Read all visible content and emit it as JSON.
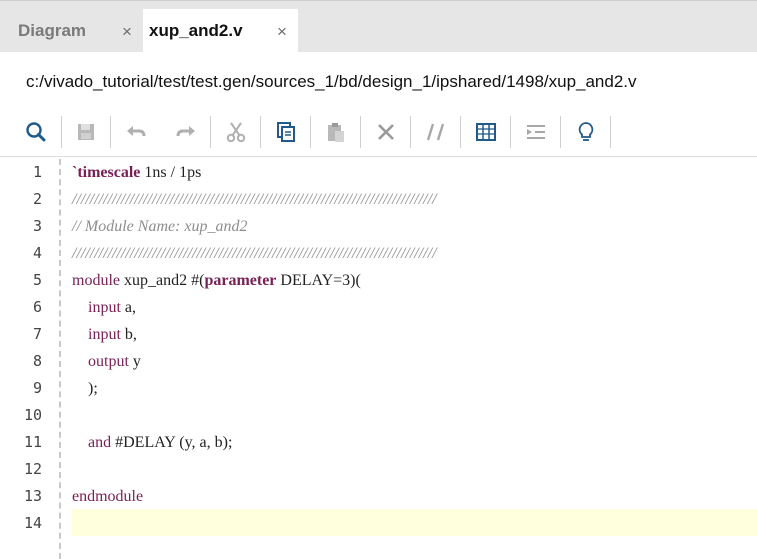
{
  "tabs": [
    {
      "label": "Diagram",
      "close": "×",
      "active": false
    },
    {
      "label": "xup_and2.v",
      "close": "×",
      "active": true
    }
  ],
  "file_path": "c:/vivado_tutorial/test/test.gen/sources_1/bd/design_1/ipshared/1498/xup_and2.v",
  "toolbar": {
    "icons": [
      "search-icon",
      "save-icon",
      "undo-icon",
      "redo-icon",
      "cut-icon",
      "copy-icon",
      "paste-icon",
      "delete-icon",
      "comment-icon",
      "column-icon",
      "indent-icon",
      "lightbulb-icon"
    ]
  },
  "editor": {
    "current_line": 14,
    "lines": [
      {
        "n": "1",
        "tokens": [
          {
            "t": "`",
            "c": "kwb"
          },
          {
            "t": "timescale",
            "c": "kwb"
          },
          {
            "t": " 1ns / 1ps",
            "c": ""
          }
        ]
      },
      {
        "n": "2",
        "tokens": [
          {
            "t": "//////////////////////////////////////////////////////////////////////////////////",
            "c": "cm"
          }
        ]
      },
      {
        "n": "3",
        "tokens": [
          {
            "t": "// Module Name: xup_and2",
            "c": "cm"
          }
        ]
      },
      {
        "n": "4",
        "tokens": [
          {
            "t": "//////////////////////////////////////////////////////////////////////////////////",
            "c": "cm"
          }
        ]
      },
      {
        "n": "5",
        "tokens": [
          {
            "t": "module",
            "c": "kw"
          },
          {
            "t": " xup_and2 #(",
            "c": ""
          },
          {
            "t": "parameter",
            "c": "kwb"
          },
          {
            "t": " DELAY=3)(",
            "c": ""
          }
        ]
      },
      {
        "n": "6",
        "tokens": [
          {
            "t": "    ",
            "c": ""
          },
          {
            "t": "input",
            "c": "kw"
          },
          {
            "t": " a,",
            "c": ""
          }
        ]
      },
      {
        "n": "7",
        "tokens": [
          {
            "t": "    ",
            "c": ""
          },
          {
            "t": "input",
            "c": "kw"
          },
          {
            "t": " b,",
            "c": ""
          }
        ]
      },
      {
        "n": "8",
        "tokens": [
          {
            "t": "    ",
            "c": ""
          },
          {
            "t": "output",
            "c": "kw"
          },
          {
            "t": " y",
            "c": ""
          }
        ]
      },
      {
        "n": "9",
        "tokens": [
          {
            "t": "    );",
            "c": ""
          }
        ]
      },
      {
        "n": "10",
        "tokens": []
      },
      {
        "n": "11",
        "tokens": [
          {
            "t": "    ",
            "c": ""
          },
          {
            "t": "and",
            "c": "kw"
          },
          {
            "t": " #DELAY (y, a, b);",
            "c": ""
          }
        ]
      },
      {
        "n": "12",
        "tokens": []
      },
      {
        "n": "13",
        "tokens": [
          {
            "t": "endmodule",
            "c": "kw"
          }
        ]
      },
      {
        "n": "14",
        "tokens": []
      }
    ]
  }
}
